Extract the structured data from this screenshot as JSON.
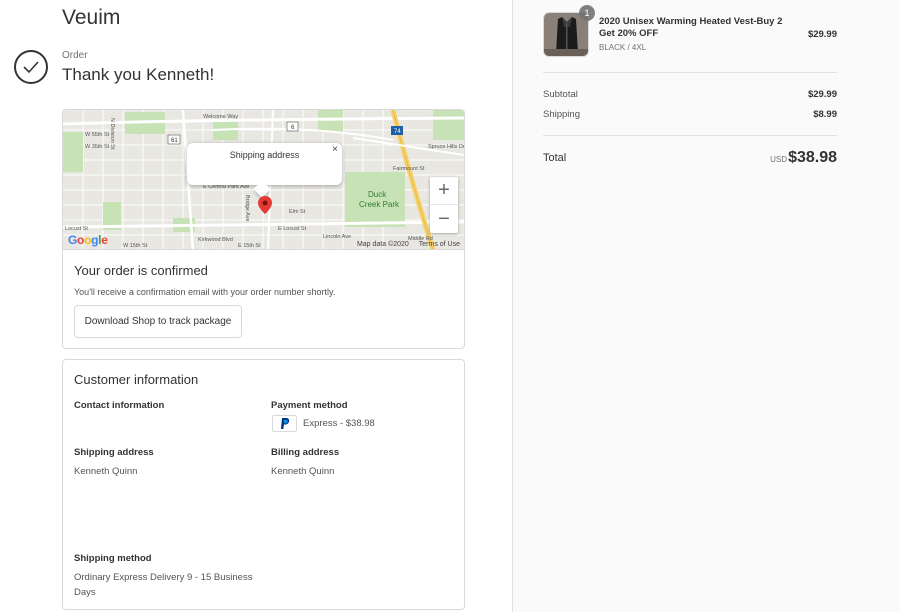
{
  "store": {
    "name": "Veuim"
  },
  "header": {
    "order_label": "Order",
    "thank_you": "Thank you Kenneth!"
  },
  "map": {
    "popup_text": "Shipping address",
    "close_glyph": "×",
    "zoom_in": "+",
    "zoom_out": "−",
    "google_logo": "Google",
    "map_data": "Map data ©2020",
    "terms": "Terms of Use",
    "park_label": "Duck Creek Park",
    "street_labels": [
      "W 55th St",
      "W 35th St",
      "E Central Park Ave",
      "Elm St",
      "Locust St",
      "E Locust St",
      "W 15th St",
      "Kirkwood Blvd",
      "E 15th St",
      "Middle Rd",
      "Spruce Hills Dr",
      "Welcome Way",
      "Lincoln Ave",
      "Fairmount St",
      "Bridge Ave",
      "N Division St"
    ],
    "shields": [
      "6",
      "61",
      "74"
    ]
  },
  "confirmation": {
    "title": "Your order is confirmed",
    "text": "You'll receive a confirmation email with your order number shortly.",
    "button": "Download Shop to track package"
  },
  "customer": {
    "title": "Customer information",
    "contact_label": "Contact information",
    "payment_label": "Payment method",
    "payment_text": "Express - $38.98",
    "shipping_address_label": "Shipping address",
    "shipping_address_name": "Kenneth Quinn",
    "billing_address_label": "Billing address",
    "billing_address_name": "Kenneth Quinn",
    "shipping_method_label": "Shipping method",
    "shipping_method_value": "Ordinary Express Delivery 9 - 15 Business Days"
  },
  "summary": {
    "product": {
      "quantity": "1",
      "name": "2020 Unisex Warming Heated Vest-Buy 2 Get 20% OFF",
      "variant": "BLACK / 4XL",
      "price": "$29.99"
    },
    "subtotal_label": "Subtotal",
    "subtotal_value": "$29.99",
    "shipping_label": "Shipping",
    "shipping_value": "$8.99",
    "total_label": "Total",
    "currency": "USD",
    "total_value": "$38.98"
  },
  "colors": {
    "paypal_dark": "#003087",
    "paypal_light": "#009cde",
    "pin": "#e53935",
    "park": "#c7e3b5",
    "highway": "#f6d26a"
  }
}
